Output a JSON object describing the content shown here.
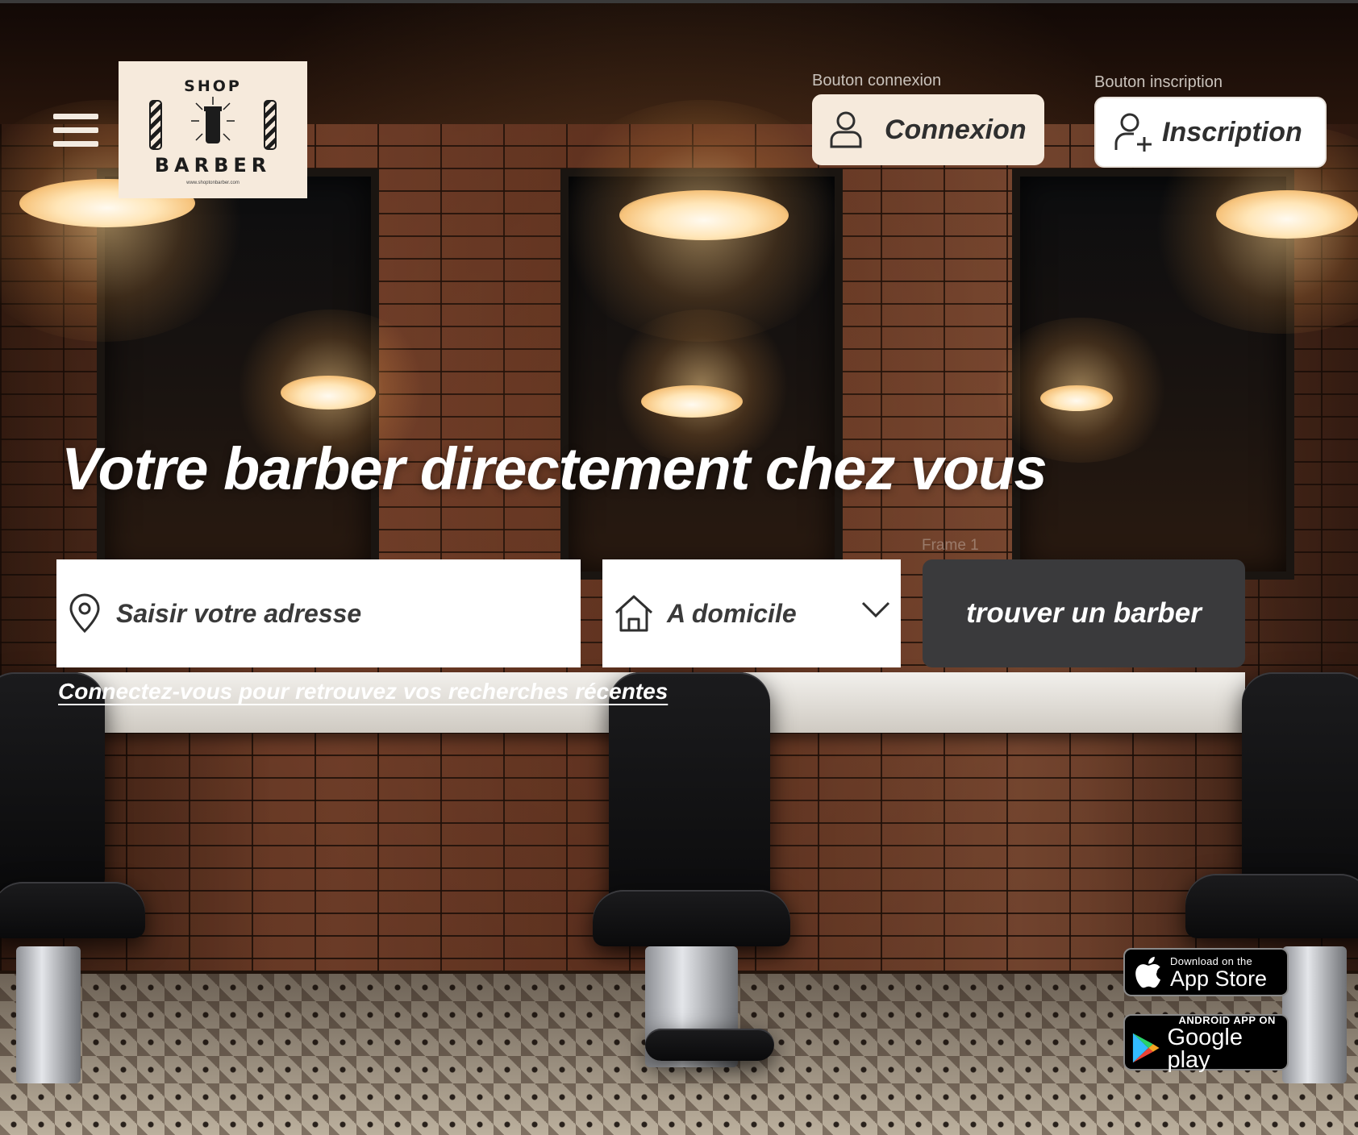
{
  "logo": {
    "top": "SHOP",
    "bottom": "BARBER",
    "url": "www.shoptonbarber.com"
  },
  "auth": {
    "connexion_caption": "Bouton connexion",
    "connexion_label": "Connexion",
    "inscription_caption": "Bouton inscription",
    "inscription_label": "Inscription"
  },
  "hero": {
    "headline": "Votre barber directement chez vous"
  },
  "frame_label": "Frame 1",
  "search": {
    "address_placeholder": "Saisir votre adresse",
    "mode_value": "A domicile",
    "submit_label": "trouver un barber"
  },
  "recent_searches_link": "Connectez-vous pour retrouvez vos recherches récentes",
  "stores": {
    "apple_small": "Download on the",
    "apple_big": "App Store",
    "google_small": "ANDROID APP ON",
    "google_big": "Google play"
  },
  "colors": {
    "accent_cream": "#f6eadc",
    "search_button": "#3a3a3c",
    "text_dark": "#2f2f2f"
  },
  "icons": [
    "menu-icon",
    "user-icon",
    "add-user-icon",
    "location-pin-icon",
    "home-icon",
    "chevron-down-icon",
    "apple-icon",
    "google-play-icon"
  ]
}
